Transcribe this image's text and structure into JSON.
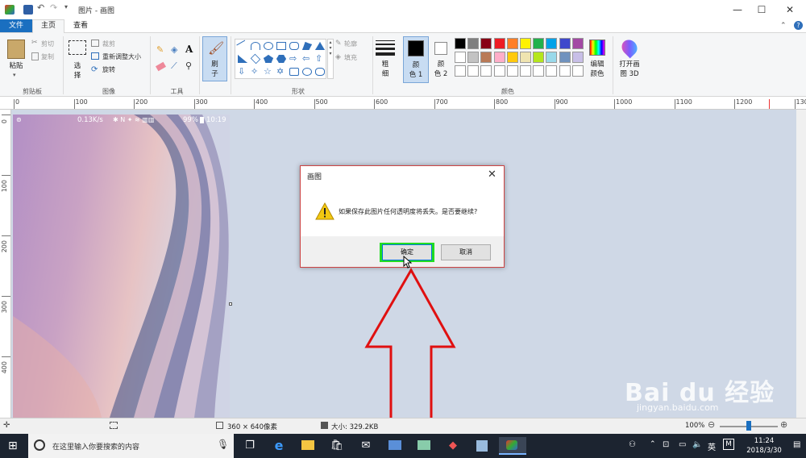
{
  "titlebar": {
    "title": "图片 - 画图",
    "min": "—",
    "max": "☐",
    "close": "✕"
  },
  "tabs": {
    "file": "文件",
    "home": "主页",
    "view": "查看"
  },
  "ribbon": {
    "clipboard": {
      "paste": "粘贴",
      "cut": "剪切",
      "copy": "复制",
      "group": "剪贴板"
    },
    "image": {
      "select": "选",
      "select2": "择",
      "crop": "裁剪",
      "resize": "重新调整大小",
      "rotate": "旋转",
      "group": "图像"
    },
    "tools": {
      "group": "工具"
    },
    "brushes": {
      "label": "刷",
      "label2": "子"
    },
    "shapes": {
      "outline": "轮廓",
      "fill": "填充",
      "group": "形状"
    },
    "size": {
      "label": "粗",
      "label2": "细"
    },
    "color1": {
      "label": "颜",
      "label2": "色 1"
    },
    "color2": {
      "label": "颜",
      "label2": "色 2"
    },
    "colors": {
      "group": "颜色",
      "edit": "编辑",
      "edit2": "颜色"
    },
    "paint3d": {
      "label": "打开画",
      "label2": "图 3D"
    },
    "palette": [
      "#000000",
      "#7f7f7f",
      "#880015",
      "#ed1c24",
      "#ff7f27",
      "#fff200",
      "#22b14c",
      "#00a2e8",
      "#3f48cc",
      "#a349a4",
      "#ffffff",
      "#c3c3c3",
      "#b97a57",
      "#ffaec9",
      "#ffc90e",
      "#efe4b0",
      "#b5e61d",
      "#99d9ea",
      "#7092be",
      "#c8bfe7",
      "#ffffff",
      "#ffffff",
      "#ffffff",
      "#ffffff",
      "#ffffff",
      "#ffffff",
      "#ffffff",
      "#ffffff",
      "#ffffff",
      "#ffffff"
    ]
  },
  "ruler": {
    "h": [
      "0",
      "100",
      "200",
      "300",
      "400",
      "500",
      "600",
      "700",
      "800",
      "900",
      "1000",
      "1100",
      "1200",
      "130"
    ],
    "v": [
      "0",
      "100",
      "200",
      "300",
      "400"
    ]
  },
  "phone_status": {
    "speed": "0.13K/s",
    "battery": "99%",
    "time": "10:19"
  },
  "dialog": {
    "title": "画图",
    "message": "如果保存此图片任何透明度将丢失。是否要继续?",
    "ok": "确定",
    "cancel": "取消"
  },
  "statusbar": {
    "dimensions": "360 × 640像素",
    "size": "大小: 329.2KB",
    "zoom": "100%"
  },
  "taskbar": {
    "search_placeholder": "在这里输入你要搜索的内容",
    "time": "11:24",
    "date": "2018/3/30",
    "lang": "英",
    "ime": "M"
  },
  "watermark": {
    "text": "Bai du 经验",
    "sub": "jingyan.baidu.com"
  }
}
